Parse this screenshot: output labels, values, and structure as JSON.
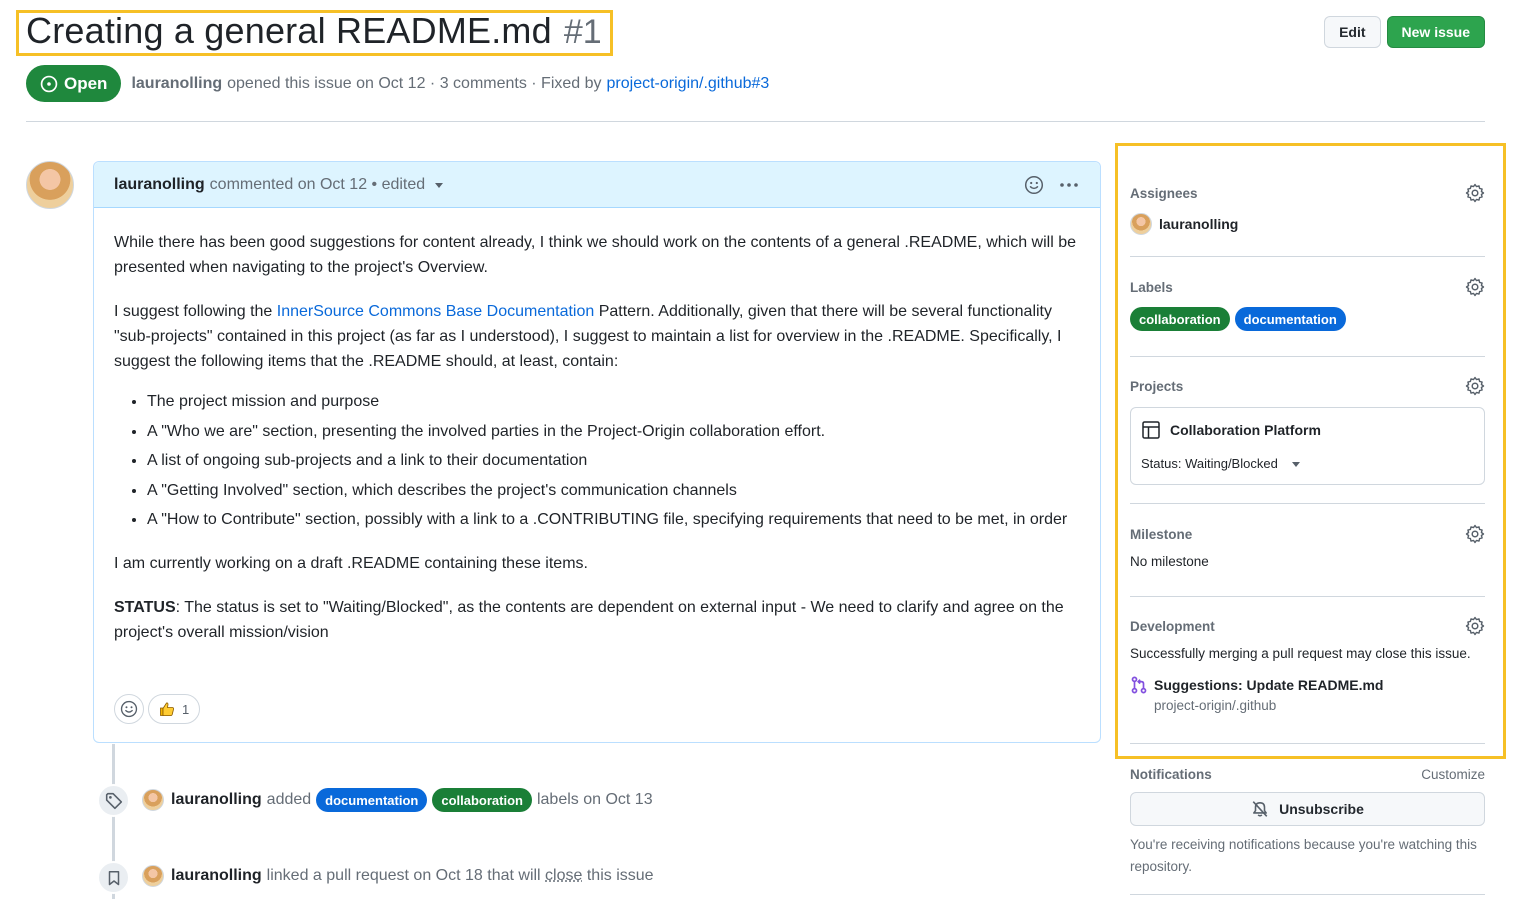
{
  "issue": {
    "title": "Creating a general README.md",
    "number": "#1",
    "state": "Open",
    "author": "lauranolling",
    "meta_text": "opened this issue on Oct 12 · 3 comments · Fixed by",
    "fixed_by": "project-origin/.github#3"
  },
  "header": {
    "edit_label": "Edit",
    "new_issue_label": "New issue"
  },
  "comment": {
    "author": "lauranolling",
    "meta": "commented on Oct 12 • edited",
    "p1": "While there has been good suggestions for content already, I think we should work on the contents of a general .README, which will be presented when navigating to the project's Overview.",
    "p2_before": "I suggest following the ",
    "p2_link": "InnerSource Commons Base Documentation",
    "p2_after": " Pattern. Additionally, given that there will be several functionality \"sub-projects\" contained in this project (as far as I understood), I suggest to maintain a list for overview in the .README. Specifically, I suggest the following items that the .README should, at least, contain:",
    "items": [
      "The project mission and purpose",
      "A \"Who we are\" section, presenting the involved parties in the Project-Origin collaboration effort.",
      "A list of ongoing sub-projects and a link to their documentation",
      "A \"Getting Involved\" section, which describes the project's communication channels",
      "A \"How to Contribute\" section, possibly with a link to a .CONTRIBUTING file, specifying requirements that need to be met, in order"
    ],
    "p3": "I am currently working on a draft .README containing these items.",
    "status_label": "STATUS",
    "status_text": ": The status is set to \"Waiting/Blocked\", as the contents are dependent on external input - We need to clarify and agree on the project's overall mission/vision",
    "thumbs_count": "1"
  },
  "timeline": {
    "event1": {
      "author": "lauranolling",
      "action": "added",
      "label_a": "documentation",
      "label_b": "collaboration",
      "suffix": "labels on Oct 13"
    },
    "event2": {
      "author": "lauranolling",
      "text_before": "linked a pull request on Oct 18 that will ",
      "close_word": "close",
      "text_after": " this issue"
    }
  },
  "sidebar": {
    "assignees_title": "Assignees",
    "assignee": "lauranolling",
    "labels_title": "Labels",
    "labels": [
      {
        "name": "collaboration",
        "color": "#1a7f37"
      },
      {
        "name": "documentation",
        "color": "#0969da"
      }
    ],
    "projects_title": "Projects",
    "project_name": "Collaboration Platform",
    "project_status": "Status: Waiting/Blocked",
    "milestone_title": "Milestone",
    "milestone_value": "No milestone",
    "development_title": "Development",
    "development_text": "Successfully merging a pull request may close this issue.",
    "pr_title": "Suggestions: Update README.md",
    "pr_repo": "project-origin/.github",
    "notifications_title": "Notifications",
    "customize_label": "Customize",
    "unsubscribe_label": "Unsubscribe",
    "notifications_note": "You're receiving notifications because you're watching this repository."
  },
  "colors": {
    "open_green": "#1f883d",
    "label_collaboration": "#1a7f37",
    "label_documentation": "#0969da",
    "highlight": "#f6c026",
    "link": "#0969da"
  },
  "icons": [
    "issue-open-icon",
    "smiley-icon",
    "kebab-icon",
    "triangle-down-icon",
    "thumbsup-icon",
    "tag-icon",
    "bookmark-icon",
    "gear-icon",
    "table-icon",
    "git-pull-request-icon",
    "bell-slash-icon"
  ]
}
